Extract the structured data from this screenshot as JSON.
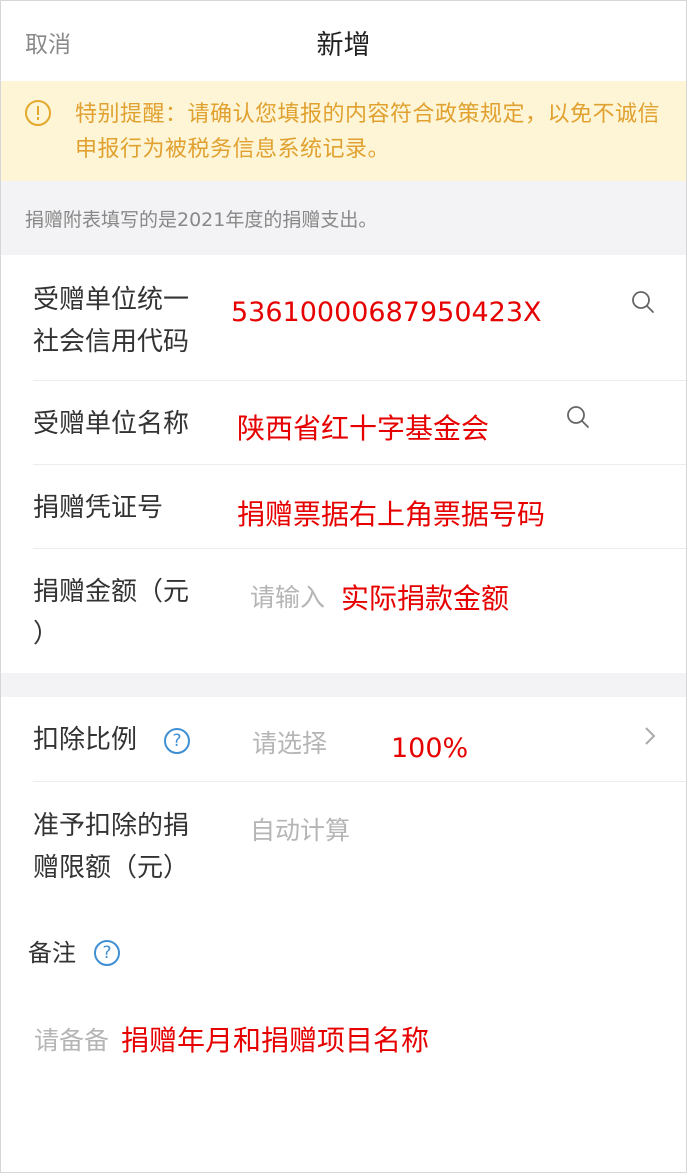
{
  "header": {
    "cancel": "取消",
    "title": "新增"
  },
  "notice": {
    "text": "特别提醒：请确认您填报的内容符合政策规定，以免不诚信申报行为被税务信息系统记录。"
  },
  "info": "捐赠附表填写的是2021年度的捐赠支出。",
  "fields": {
    "credit_code": {
      "label_line1": "受赠单位统一",
      "label_line2": "社会信用代码",
      "value": "53610000687950423X"
    },
    "name": {
      "label": "受赠单位名称",
      "value": "陕西省红十字基金会"
    },
    "voucher": {
      "label": "捐赠凭证号",
      "value": "捐赠票据右上角票据号码"
    },
    "amount": {
      "label_line1": "捐赠金额（元",
      "label_line2": "）",
      "placeholder": "请输入",
      "value": "实际捐款金额"
    },
    "ratio": {
      "label": "扣除比例",
      "placeholder": "请选择",
      "value": "100%"
    },
    "limit": {
      "label_line1": "准予扣除的捐",
      "label_line2": "赠限额（元）",
      "value": "自动计算"
    },
    "remark": {
      "label": "备注",
      "placeholder": "请备备",
      "value": "捐赠年月和捐赠项目名称"
    }
  },
  "icons": {
    "info": "info-circle-icon",
    "search": "search-icon",
    "help": "question-circle-icon",
    "chevron": "chevron-right-icon"
  },
  "colors": {
    "notice_bg": "#fdf5d5",
    "notice_text": "#e1a130",
    "annotation": "#e60000",
    "help_icon": "#3f8fd4"
  }
}
